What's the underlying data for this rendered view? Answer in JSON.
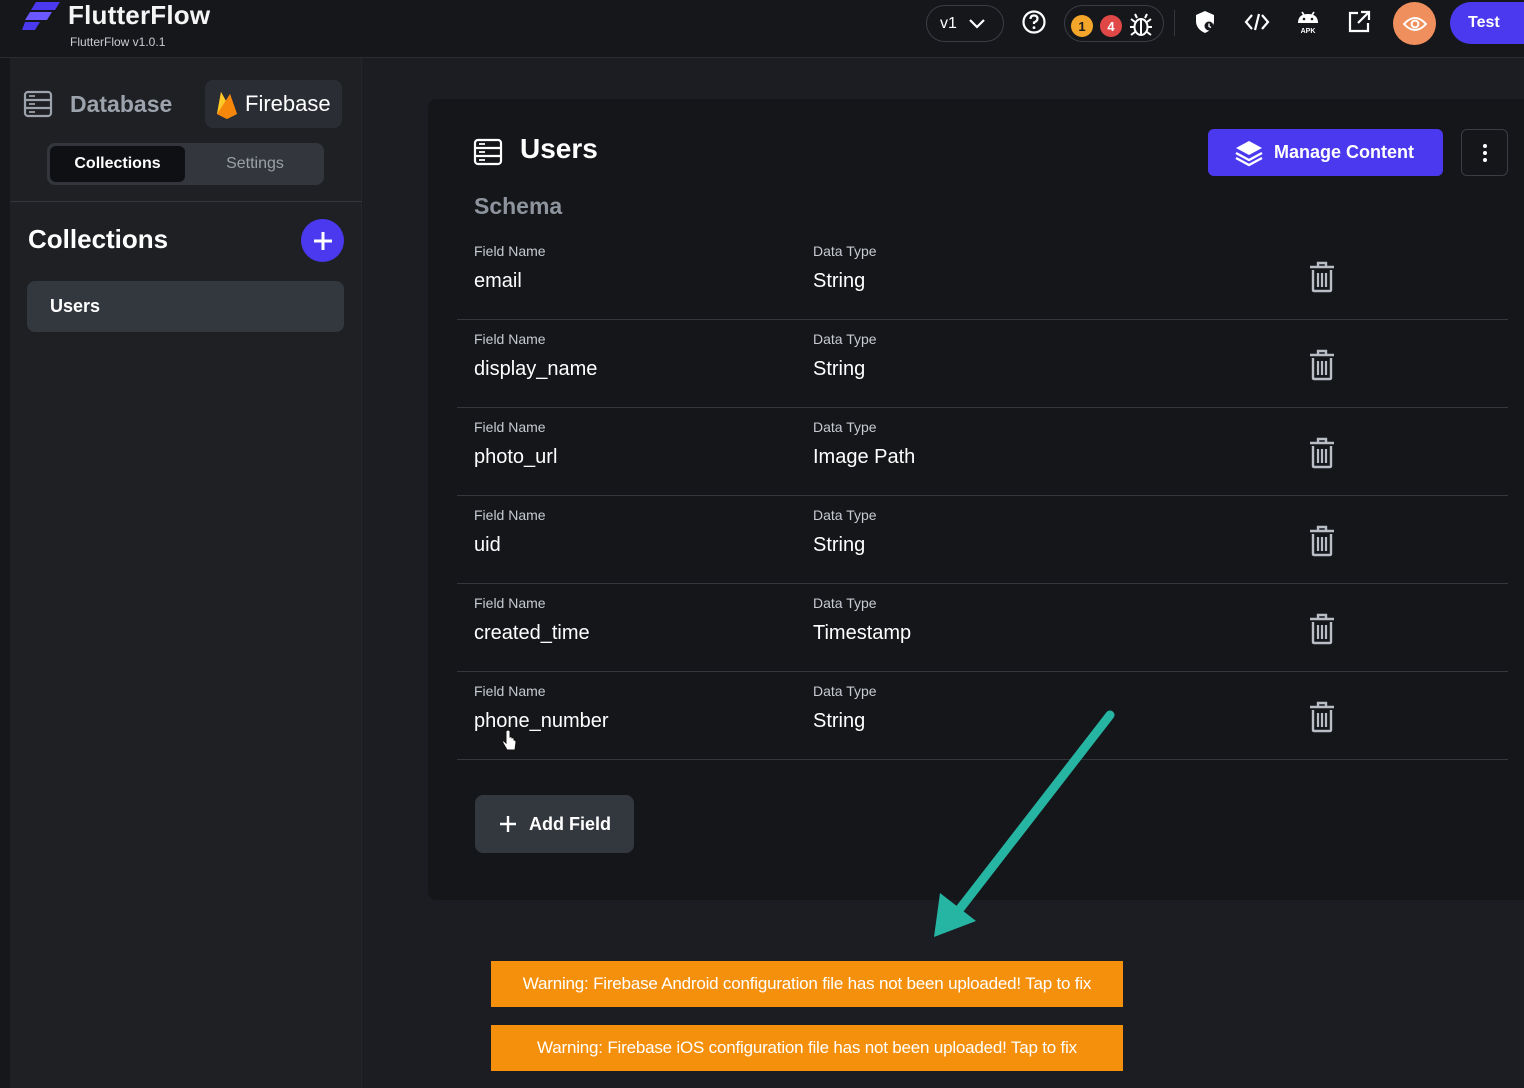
{
  "app": {
    "title": "FlutterFlow",
    "version": "FlutterFlow v1.0.1"
  },
  "topbar": {
    "version_select": "v1",
    "warnings_count": "1",
    "errors_count": "4",
    "test_label": "Test",
    "icons": [
      "help-icon",
      "bug-icon",
      "shield-icon",
      "code-icon",
      "apk-icon",
      "open-external-icon",
      "eye-icon"
    ]
  },
  "sidebar": {
    "title": "Database",
    "provider": "Firebase",
    "tabs": {
      "collections": "Collections",
      "settings": "Settings"
    },
    "collections_heading": "Collections",
    "collections": [
      "Users"
    ]
  },
  "collection": {
    "title": "Users",
    "manage_label": "Manage Content",
    "schema_label": "Schema",
    "field_name_label": "Field Name",
    "data_type_label": "Data Type",
    "fields": [
      {
        "name": "email",
        "type": "String"
      },
      {
        "name": "display_name",
        "type": "String"
      },
      {
        "name": "photo_url",
        "type": "Image Path"
      },
      {
        "name": "uid",
        "type": "String"
      },
      {
        "name": "created_time",
        "type": "Timestamp"
      },
      {
        "name": "phone_number",
        "type": "String"
      }
    ],
    "add_field_label": "Add Field"
  },
  "warnings": [
    "Warning: Firebase Android configuration file has not been uploaded! Tap to fix",
    "Warning: Firebase iOS configuration file has not been uploaded! Tap to fix"
  ],
  "colors": {
    "accent": "#4b39ef",
    "warning": "#f5900c",
    "annotation_arrow": "#26b5a2",
    "preview": "#ef8f5d"
  }
}
